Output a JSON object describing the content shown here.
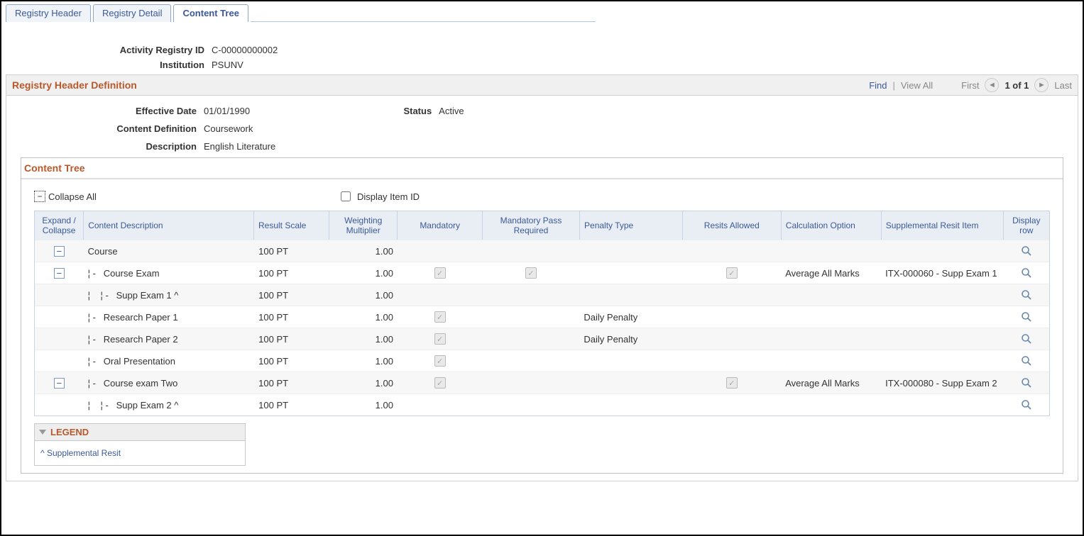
{
  "tabs": [
    {
      "label": "Registry Header",
      "active": false
    },
    {
      "label": "Registry Detail",
      "active": false
    },
    {
      "label": "Content Tree",
      "active": true
    }
  ],
  "header": {
    "registry_id_label": "Activity Registry ID",
    "registry_id_value": "C-00000000002",
    "institution_label": "Institution",
    "institution_value": "PSUNV"
  },
  "section": {
    "title": "Registry Header Definition",
    "find": "Find",
    "view_all": "View All",
    "first": "First",
    "count": "1 of 1",
    "last": "Last"
  },
  "def": {
    "eff_date_label": "Effective Date",
    "eff_date_value": "01/01/1990",
    "status_label": "Status",
    "status_value": "Active",
    "content_def_label": "Content Definition",
    "content_def_value": "Coursework",
    "desc_label": "Description",
    "desc_value": "English Literature"
  },
  "tree": {
    "title": "Content Tree",
    "collapse_all": "Collapse All",
    "display_id": "Display Item ID",
    "columns": {
      "expand": "Expand / Collapse",
      "desc": "Content Description",
      "scale": "Result Scale",
      "mult": "Weighting Multiplier",
      "mand": "Mandatory",
      "pass": "Mandatory Pass Required",
      "pen": "Penalty Type",
      "resit": "Resits Allowed",
      "calc": "Calculation Option",
      "supp": "Supplemental Resit Item",
      "disp": "Display row"
    },
    "rows": [
      {
        "exp": true,
        "level": 0,
        "desc": "Course",
        "scale": "100 PT",
        "mult": "1.00",
        "mand": false,
        "pass": false,
        "pen": "",
        "resit": false,
        "calc": "",
        "supp": ""
      },
      {
        "exp": true,
        "level": 1,
        "desc": "Course Exam",
        "scale": "100 PT",
        "mult": "1.00",
        "mand": true,
        "pass": true,
        "pen": "",
        "resit": true,
        "calc": "Average All Marks",
        "supp": "ITX-000060 - Supp Exam 1"
      },
      {
        "exp": false,
        "level": 2,
        "desc": "Supp Exam 1 ^",
        "scale": "100 PT",
        "mult": "1.00",
        "mand": false,
        "pass": false,
        "pen": "",
        "resit": false,
        "calc": "",
        "supp": ""
      },
      {
        "exp": false,
        "level": 1,
        "desc": "Research Paper 1",
        "scale": "100 PT",
        "mult": "1.00",
        "mand": true,
        "pass": false,
        "pen": "Daily Penalty",
        "resit": false,
        "calc": "",
        "supp": ""
      },
      {
        "exp": false,
        "level": 1,
        "desc": "Research Paper 2",
        "scale": "100 PT",
        "mult": "1.00",
        "mand": true,
        "pass": false,
        "pen": "Daily Penalty",
        "resit": false,
        "calc": "",
        "supp": ""
      },
      {
        "exp": false,
        "level": 1,
        "desc": "Oral Presentation",
        "scale": "100 PT",
        "mult": "1.00",
        "mand": true,
        "pass": false,
        "pen": "",
        "resit": false,
        "calc": "",
        "supp": ""
      },
      {
        "exp": true,
        "level": 1,
        "desc": "Course exam Two",
        "scale": "100 PT",
        "mult": "1.00",
        "mand": true,
        "pass": false,
        "pen": "",
        "resit": true,
        "calc": "Average All Marks",
        "supp": "ITX-000080 - Supp Exam 2"
      },
      {
        "exp": false,
        "level": 2,
        "desc": "Supp Exam 2 ^",
        "scale": "100 PT",
        "mult": "1.00",
        "mand": false,
        "pass": false,
        "pen": "",
        "resit": false,
        "calc": "",
        "supp": ""
      }
    ]
  },
  "legend": {
    "title": "LEGEND",
    "item": "^ Supplemental Resit"
  }
}
